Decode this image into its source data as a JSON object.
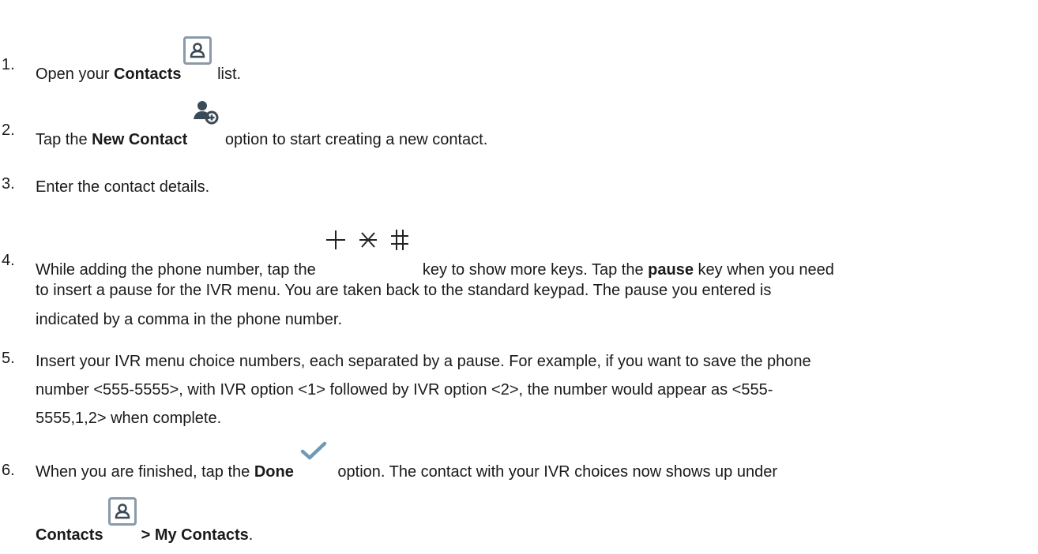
{
  "steps": [
    {
      "num": "1.",
      "a": "Open your ",
      "b1": "Contacts",
      "c": " list."
    },
    {
      "num": "2.",
      "a": "Tap the ",
      "b1": "New Contact",
      "c": " option to start creating a new contact."
    },
    {
      "num": "3.",
      "a": "Enter the contact details."
    },
    {
      "num": "4.",
      "a": "While adding the phone number, tap the ",
      "c": " key to show more keys. Tap the ",
      "b2": "pause",
      "d": " key when you need",
      "l2": "to insert a pause for the IVR menu. You are taken back to the standard keypad. The pause you entered is",
      "l3": "indicated by a comma in the phone number."
    },
    {
      "num": "5.",
      "a": "Insert your IVR menu choice numbers, each separated by a pause. For example, if you want to save the phone",
      "l2": "number <555-5555>, with IVR option <1> followed by IVR option <2>, the number would appear as <555-",
      "l3": "5555,1,2> when complete."
    },
    {
      "num": "6.",
      "a": "When you are finished, tap the ",
      "b1": "Done",
      "c": " option. The contact with your IVR choices now shows up under",
      "b2": "Contacts",
      "b3": "> My Contacts",
      "d": "."
    }
  ],
  "icons": {
    "step1": "contacts-icon",
    "step2": "new-contact-icon",
    "step4": "plus-star-hash-keys-icon",
    "step6_check": "done-checkmark-icon",
    "step6_contacts": "contacts-icon"
  },
  "colors": {
    "icon_gray": "#8a9aa8",
    "icon_dark": "#3b4a57",
    "check_blue": "#6f9ab7",
    "text": "#1a1a1a"
  }
}
